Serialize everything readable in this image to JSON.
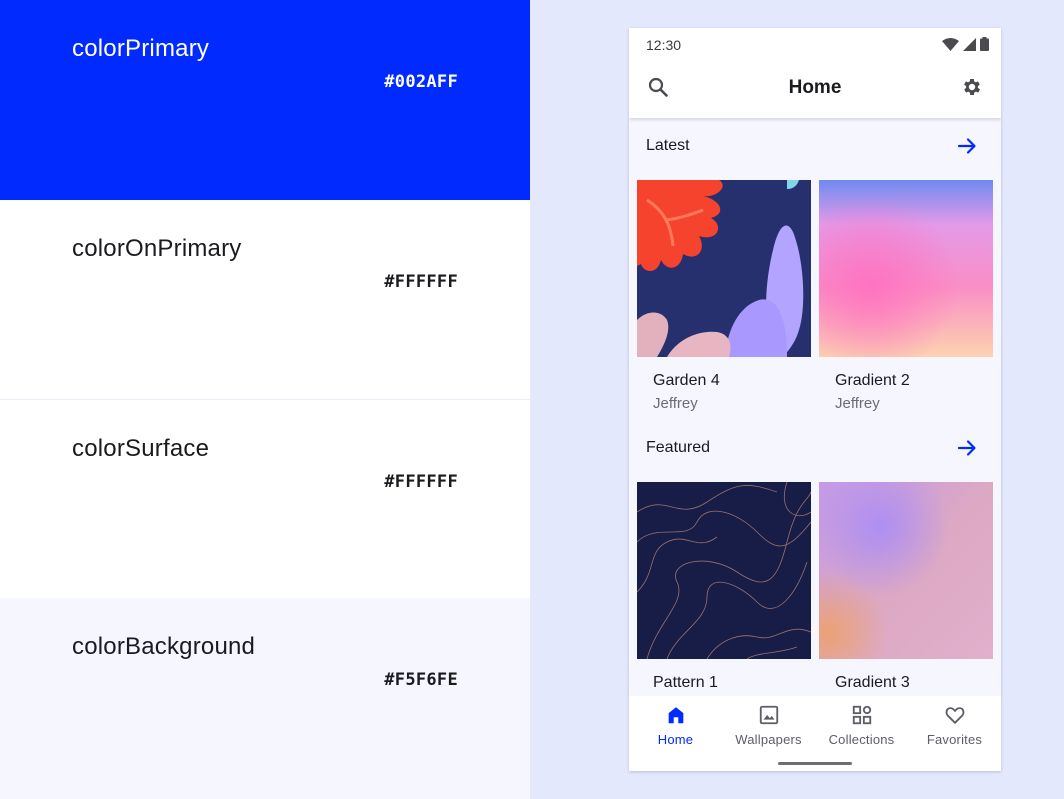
{
  "colors": {
    "primary": "#002AFF",
    "on_primary": "#FFFFFF",
    "surface": "#FFFFFF",
    "background": "#F5F6FE",
    "accent": "#002aff"
  },
  "swatches": [
    {
      "name": "colorPrimary",
      "hex": "#002AFF"
    },
    {
      "name": "colorOnPrimary",
      "hex": "#FFFFFF"
    },
    {
      "name": "colorSurface",
      "hex": "#FFFFFF"
    },
    {
      "name": "colorBackground",
      "hex": "#F5F6FE"
    }
  ],
  "phone": {
    "status_time": "12:30",
    "status_icons": [
      "wifi-icon",
      "signal-icon",
      "battery-icon"
    ],
    "title": "Home",
    "sections": [
      {
        "label": "Latest",
        "cards": [
          {
            "title": "Garden 4",
            "author": "Jeffrey",
            "art": "garden"
          },
          {
            "title": "Gradient 2",
            "author": "Jeffrey",
            "art": "gradient-pink"
          }
        ]
      },
      {
        "label": "Featured",
        "cards": [
          {
            "title": "Pattern 1",
            "art": "pattern-topo"
          },
          {
            "title": "Gradient 3",
            "art": "gradient-purple"
          }
        ]
      }
    ],
    "nav": [
      {
        "label": "Home",
        "icon": "home-icon",
        "active": true
      },
      {
        "label": "Wallpapers",
        "icon": "image-icon",
        "active": false
      },
      {
        "label": "Collections",
        "icon": "grid-icon",
        "active": false
      },
      {
        "label": "Favorites",
        "icon": "heart-icon",
        "active": false
      }
    ]
  }
}
